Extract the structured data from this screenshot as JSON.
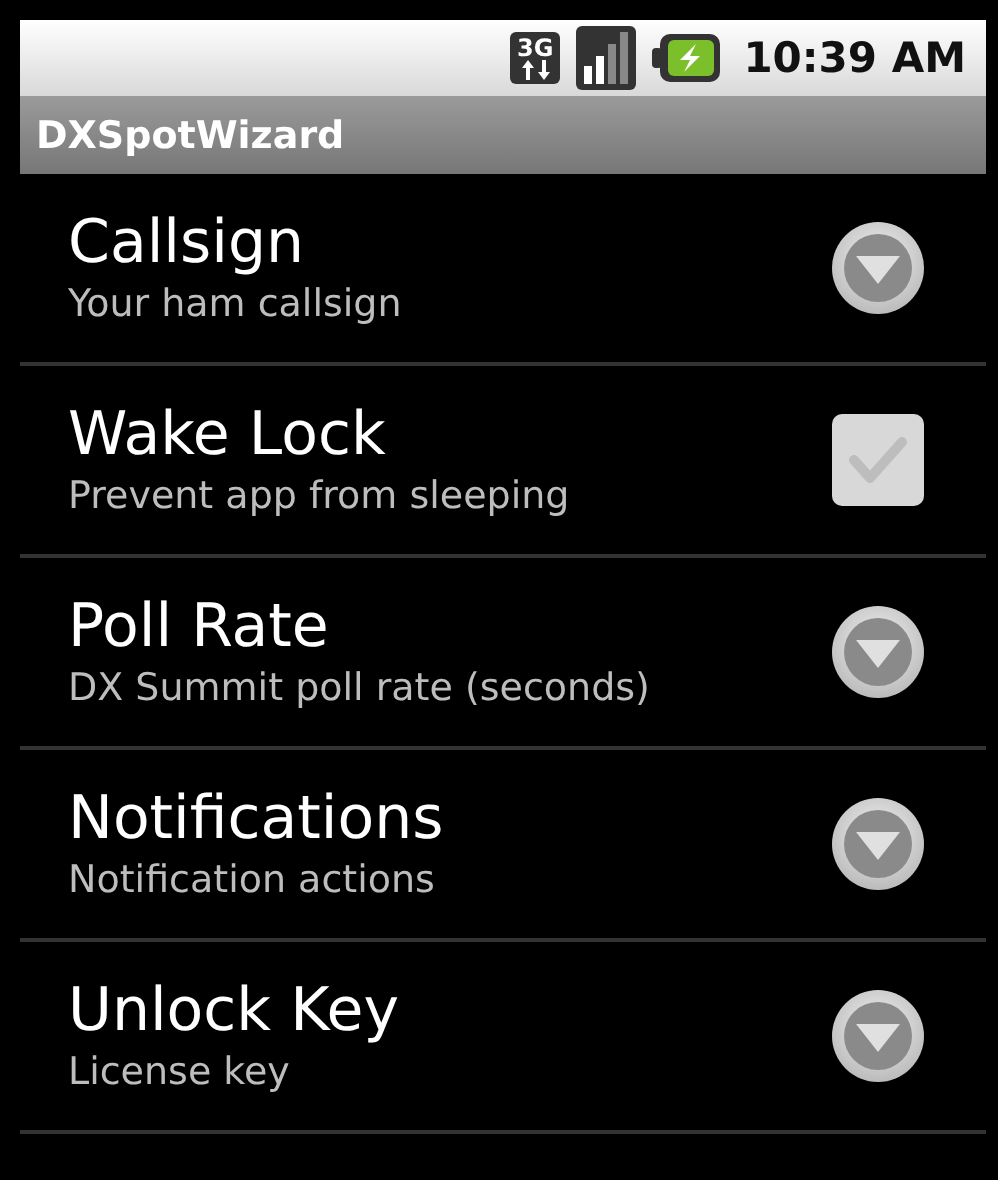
{
  "status_bar": {
    "network": "3G",
    "time": "10:39 AM"
  },
  "window": {
    "title": "DXSpotWizard"
  },
  "preferences": [
    {
      "kind": "list",
      "title": "Callsign",
      "summary": "Your ham callsign"
    },
    {
      "kind": "checkbox",
      "title": "Wake Lock",
      "summary": "Prevent app from sleeping",
      "checked": false
    },
    {
      "kind": "list",
      "title": "Poll Rate",
      "summary": "DX Summit poll rate (seconds)"
    },
    {
      "kind": "list",
      "title": "Notifications",
      "summary": "Notification actions"
    },
    {
      "kind": "list",
      "title": "Unlock Key",
      "summary": "License key"
    }
  ]
}
